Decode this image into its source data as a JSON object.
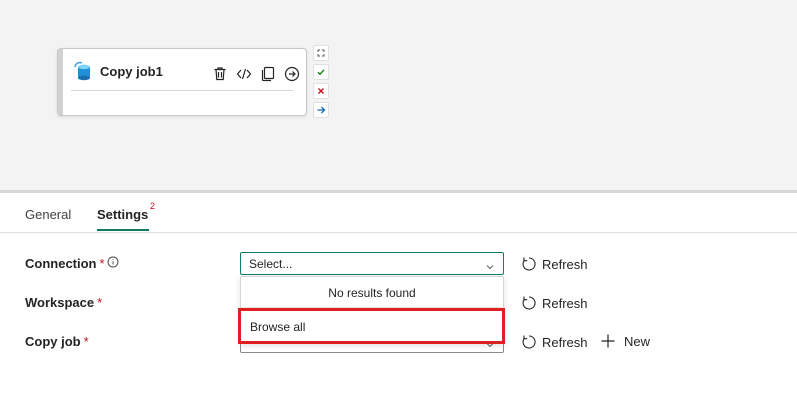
{
  "activity": {
    "title": "Copy job1",
    "actions": [
      "delete-icon",
      "code-icon",
      "copy-icon",
      "run-icon"
    ],
    "side_actions": [
      "autofit-icon",
      "success-icon",
      "fail-icon",
      "next-icon"
    ]
  },
  "tabs": [
    {
      "label": "General"
    },
    {
      "label": "Settings",
      "badge": "2",
      "active": true
    }
  ],
  "form": {
    "connection": {
      "label": "Connection",
      "required": "*",
      "info_icon": "info-icon",
      "select_value": "Select...",
      "dropdown": {
        "empty_text": "No results found",
        "browse_all": "Browse all"
      },
      "refresh_label": "Refresh"
    },
    "workspace": {
      "label": "Workspace",
      "required": "*",
      "refresh_label": "Refresh"
    },
    "copy_job": {
      "label": "Copy job",
      "required": "*",
      "refresh_label": "Refresh",
      "new_label": "New"
    }
  },
  "colors": {
    "accent": "#117865",
    "required": "#c50f1f",
    "highlight": "#e02020",
    "canvas": "#f3f3f3"
  }
}
